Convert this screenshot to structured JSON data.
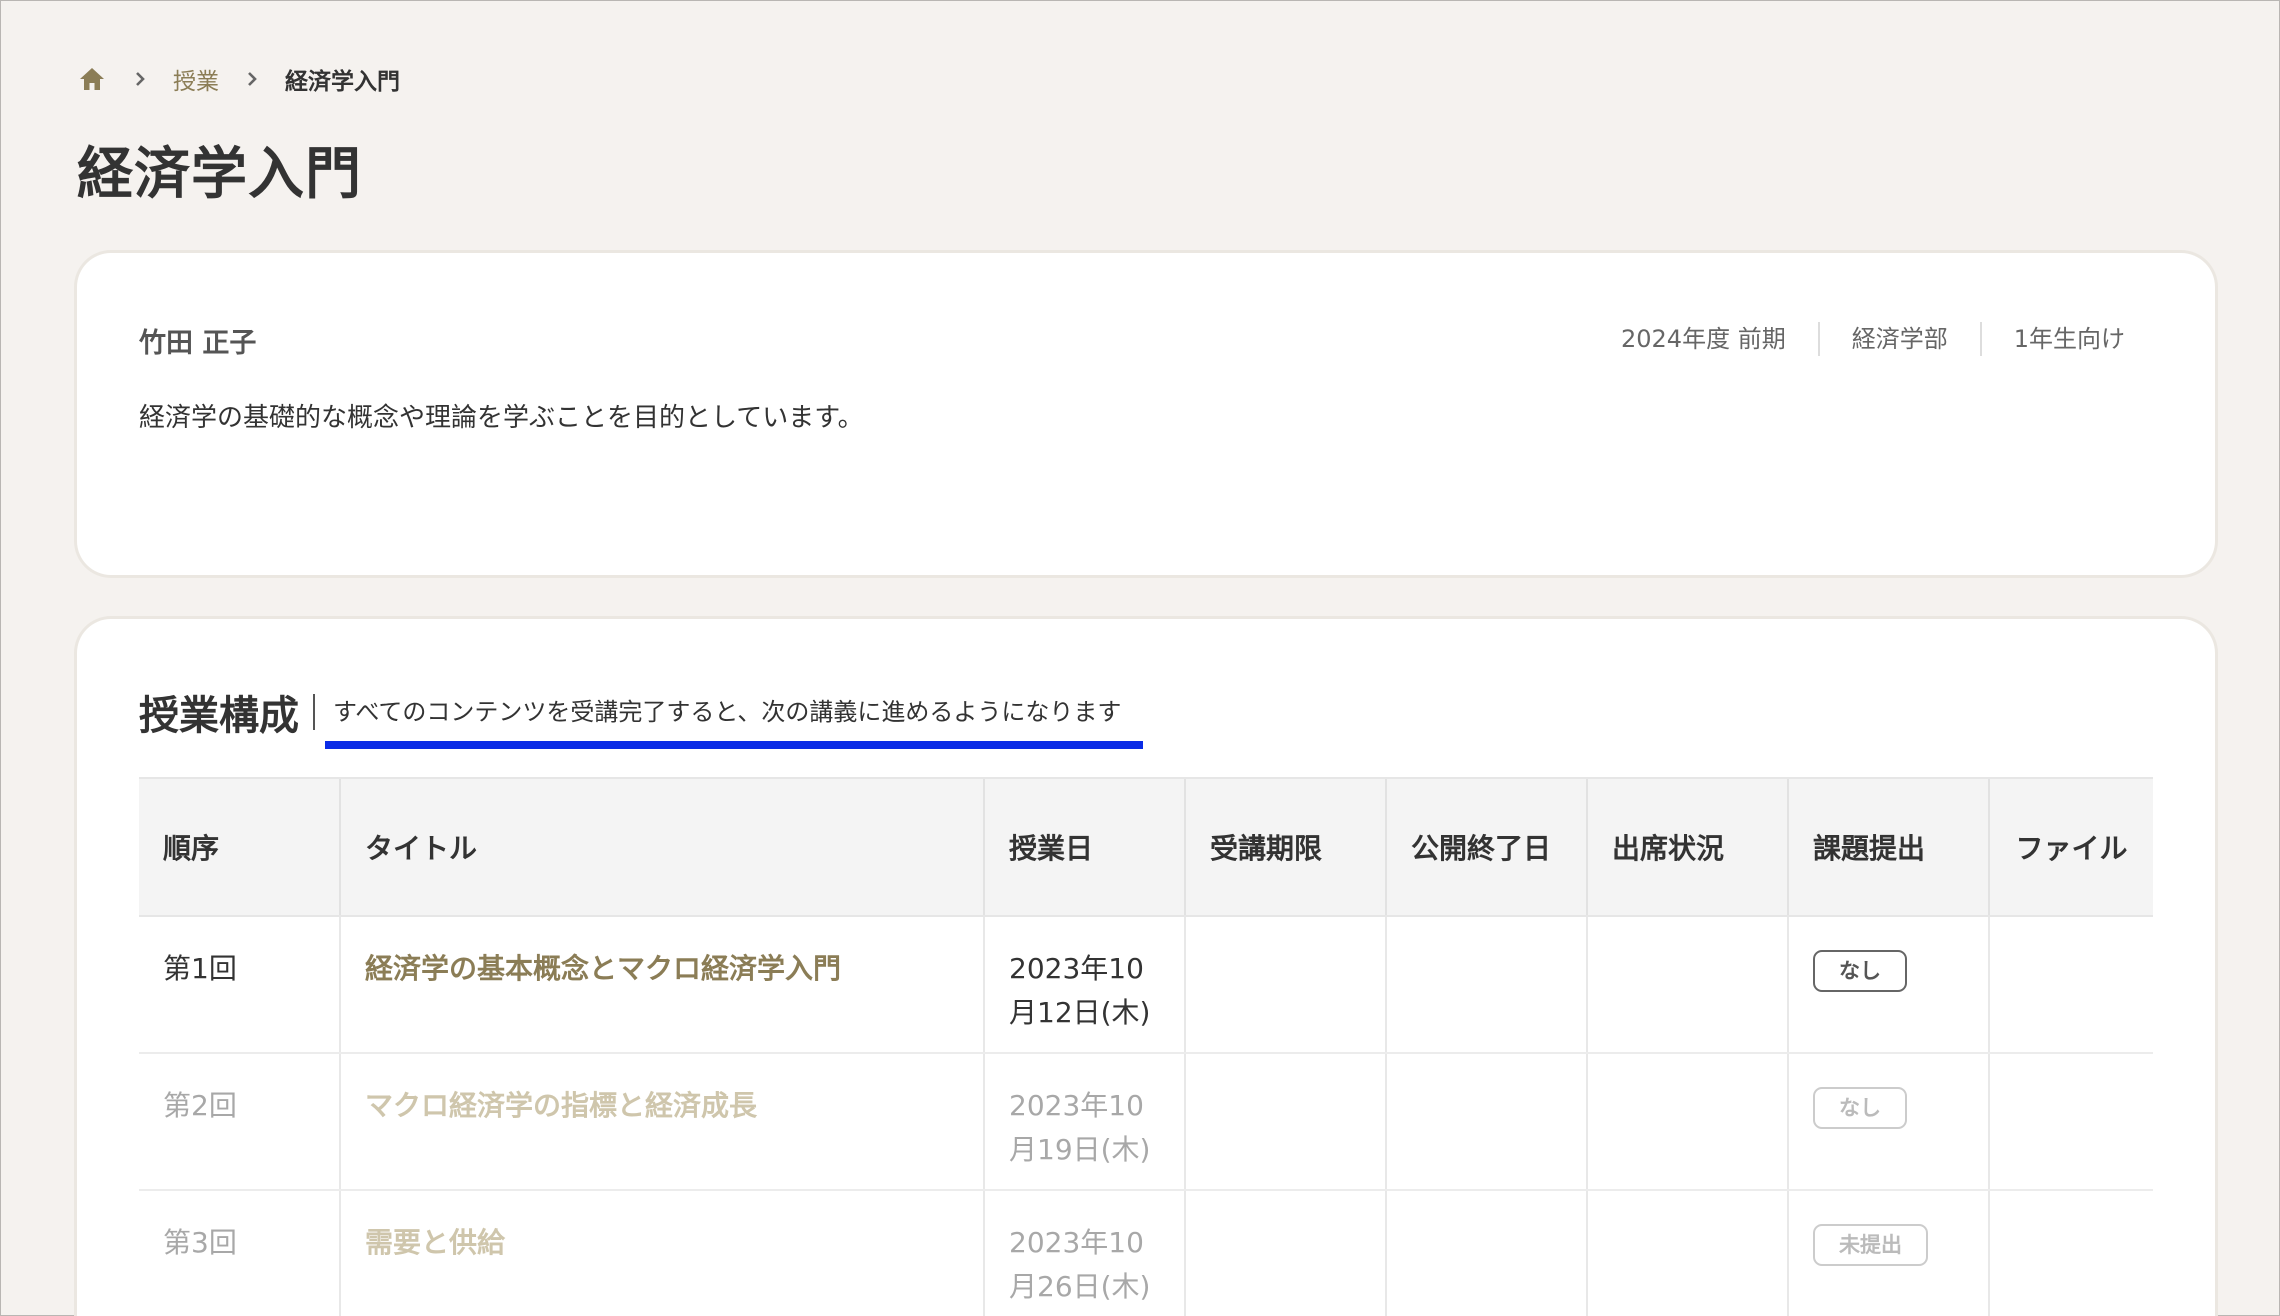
{
  "breadcrumb": {
    "home_icon": "home-icon",
    "separator_icon": "chevron-right-icon",
    "link": "授業",
    "current": "経済学入門"
  },
  "page_title": "経済学入門",
  "course_info": {
    "teacher": "竹田 正子",
    "meta": [
      "2024年度 前期",
      "経済学部",
      "1年生向け"
    ],
    "description": "経済学の基礎的な概念や理論を学ぶことを目的としています。"
  },
  "course_structure": {
    "title": "授業構成",
    "note": "すべてのコンテンツを受講完了すると、次の講義に進めるようになります",
    "columns": [
      "順序",
      "タイトル",
      "授業日",
      "受講期限",
      "公開終了日",
      "出席状況",
      "課題提出",
      "ファイル"
    ],
    "rows": [
      {
        "order": "第1回",
        "title": "経済学の基本概念とマクロ経済学入門",
        "date_line1": "2023年10",
        "date_line2": "月12日(木)",
        "deadline": "",
        "end_date": "",
        "attendance": "",
        "submission": "なし",
        "file": ""
      },
      {
        "order": "第2回",
        "title": "マクロ経済学の指標と経済成長",
        "date_line1": "2023年10",
        "date_line2": "月19日(木)",
        "deadline": "",
        "end_date": "",
        "attendance": "",
        "submission": "なし",
        "file": ""
      },
      {
        "order": "第3回",
        "title": "需要と供給",
        "date_line1": "2023年10",
        "date_line2": "月26日(木)",
        "deadline": "",
        "end_date": "",
        "attendance": "",
        "submission": "未提出",
        "file": ""
      }
    ]
  },
  "colors": {
    "accent": "#8b7d56",
    "highlight": "#0a2be6",
    "background": "#f5f2ef"
  }
}
